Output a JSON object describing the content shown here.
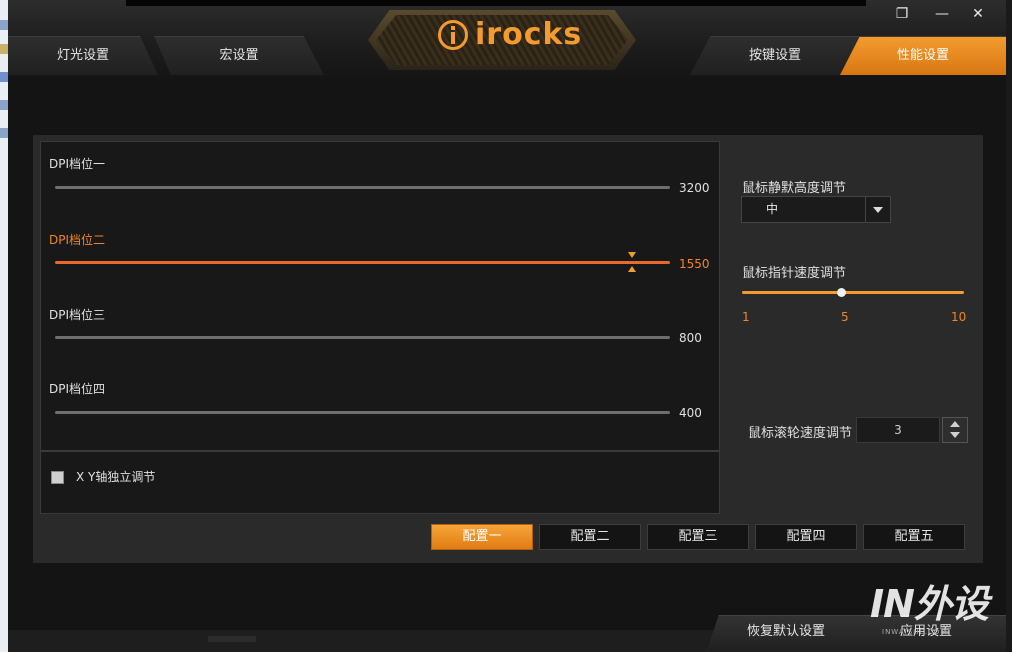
{
  "header": {
    "brand": "irocks",
    "tabs": [
      {
        "label": "灯光设置",
        "active": false
      },
      {
        "label": "宏设置",
        "active": false
      },
      {
        "label": "按键设置",
        "active": false
      },
      {
        "label": "性能设置",
        "active": true
      }
    ]
  },
  "window_controls": {
    "restore": "❐",
    "minimize": "—",
    "close": "✕"
  },
  "dpi": {
    "levels": [
      {
        "label": "DPI档位一",
        "value": "3200",
        "active": false
      },
      {
        "label": "DPI档位二",
        "value": "1550",
        "active": true
      },
      {
        "label": "DPI档位三",
        "value": "800",
        "active": false
      },
      {
        "label": "DPI档位四",
        "value": "400",
        "active": false
      }
    ]
  },
  "xy_independent": {
    "label": "X Y轴独立调节",
    "checked": false
  },
  "lift_off": {
    "label": "鼠标静默高度调节",
    "value": "中"
  },
  "pointer_speed": {
    "label": "鼠标指针速度调节",
    "min": "1",
    "mid": "5",
    "max": "10",
    "value": 5
  },
  "wheel_speed": {
    "label": "鼠标滚轮速度调节",
    "value": "3"
  },
  "profiles": [
    {
      "label": "配置一",
      "active": true
    },
    {
      "label": "配置二",
      "active": false
    },
    {
      "label": "配置三",
      "active": false
    },
    {
      "label": "配置四",
      "active": false
    },
    {
      "label": "配置五",
      "active": false
    }
  ],
  "footer": {
    "restore_label": "恢复默认设置",
    "apply_label": "应用设置"
  },
  "watermark": {
    "main": "IN外设",
    "sub": "INWAISHE.COM"
  },
  "colors": {
    "accent": "#f39b2f",
    "active_slider": "#e8692a",
    "panel": "#2a2a2a"
  }
}
